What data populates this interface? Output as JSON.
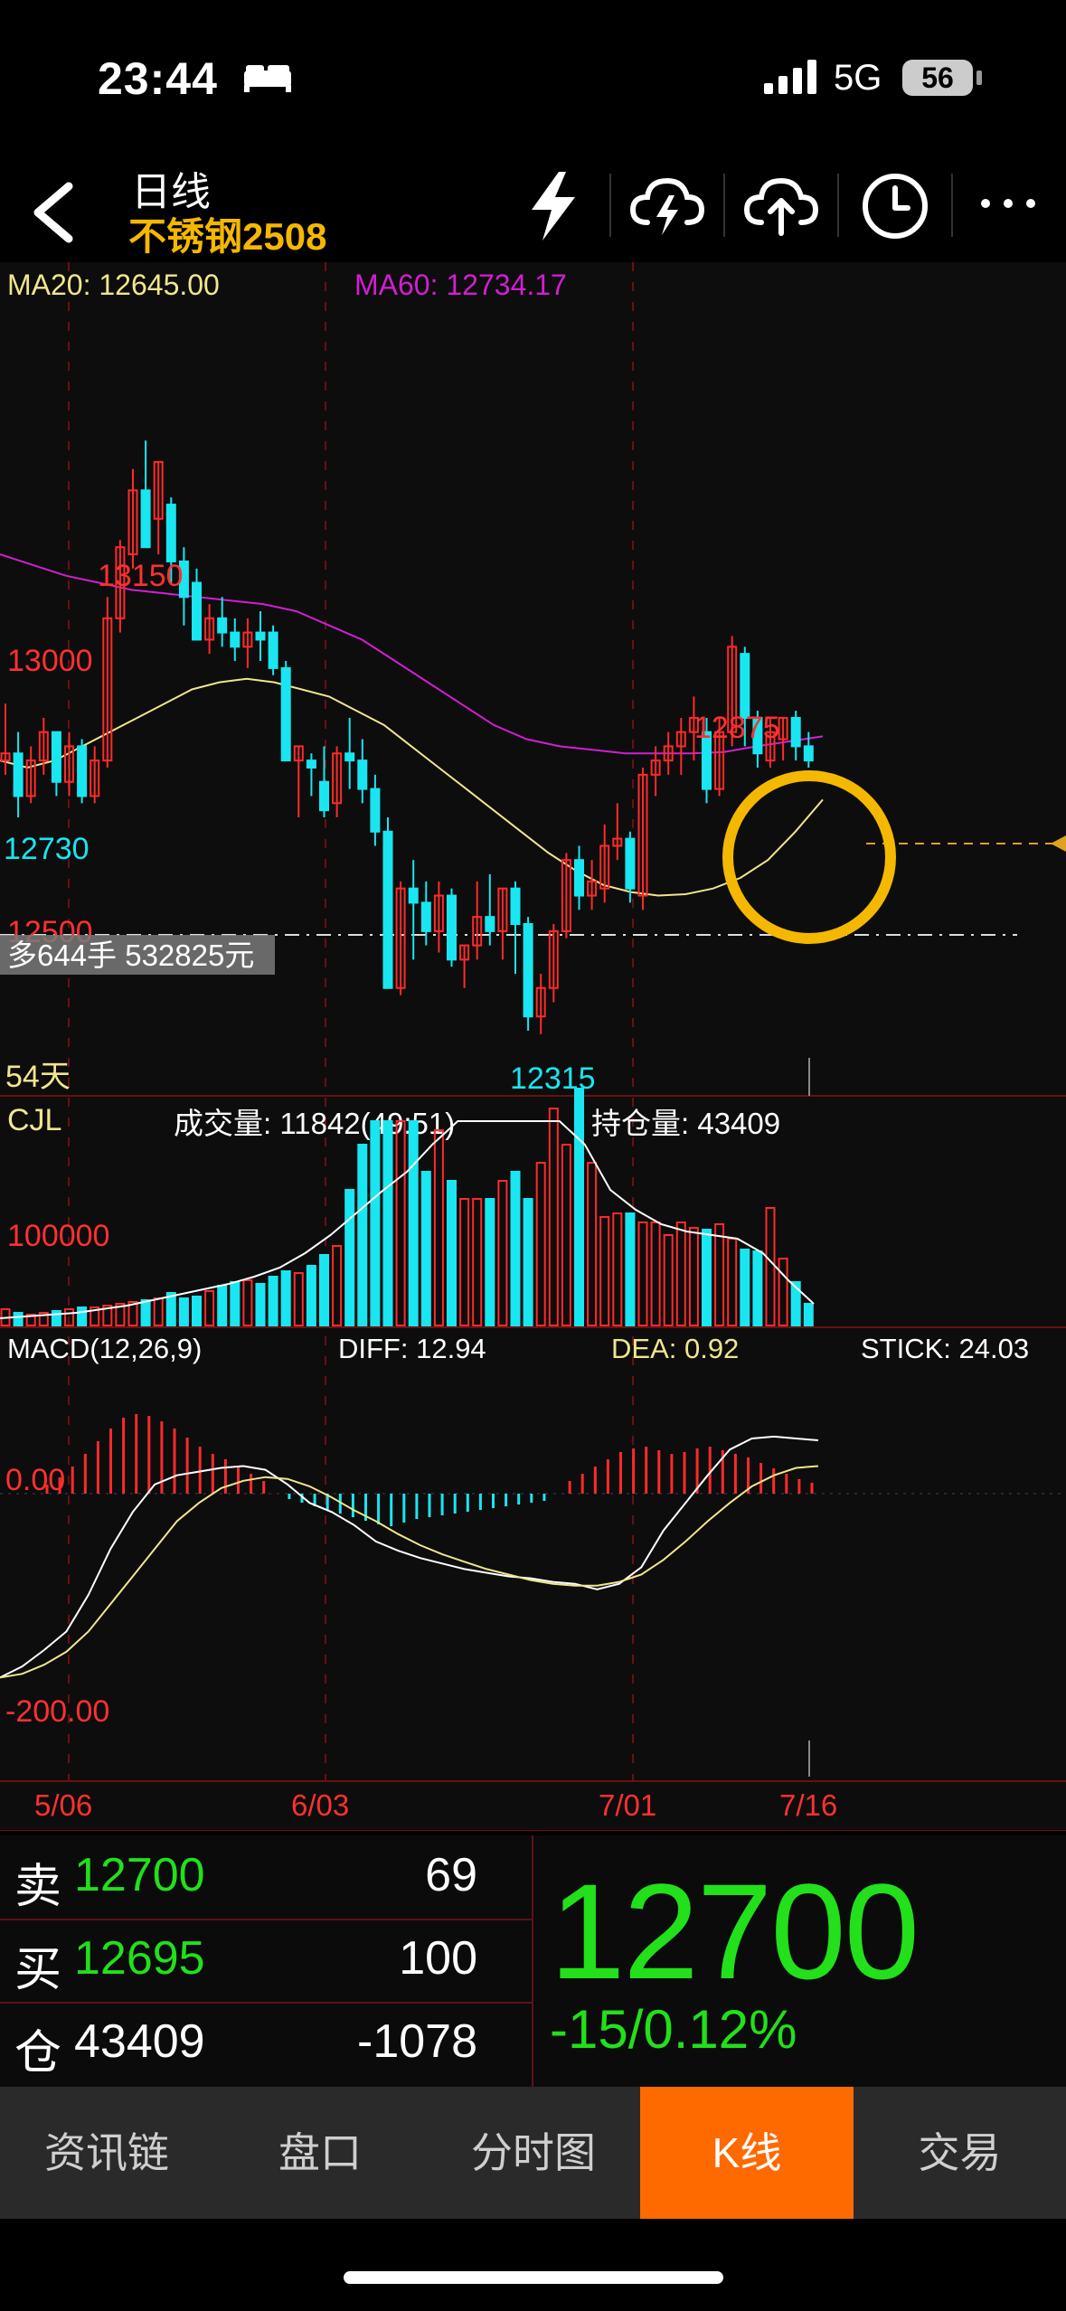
{
  "status_bar": {
    "time": "23:44",
    "network": "5G",
    "battery": "56"
  },
  "header": {
    "period": "日线",
    "symbol": "不锈钢2508"
  },
  "header_icons": [
    "flash-icon",
    "cloud-lightning-icon",
    "cloud-upload-icon",
    "clock-icon",
    "more-icon"
  ],
  "main_chart": {
    "ma20_label": "MA20: 12645.00",
    "ma60_label": "MA60: 12734.17",
    "high_label": "13150",
    "level_13000": "13000",
    "level_12730": "12730",
    "level_12500": "12500",
    "peak_label": "12875",
    "low_label": "12315",
    "position_tag": "多644手 532825元",
    "days_label": "54天"
  },
  "volume_chart": {
    "title": "CJL",
    "volume_label": "成交量: 11842(49:51)",
    "open_interest_label": "持仓量: 43409",
    "level_label": "100000"
  },
  "macd_chart": {
    "title": "MACD(12,26,9)",
    "diff_label": "DIFF: 12.94",
    "dea_label": "DEA: 0.92",
    "stick_label": "STICK: 24.03",
    "zero_label": "0.00",
    "low_label": "-200.00"
  },
  "x_axis": {
    "d1": "5/06",
    "d2": "6/03",
    "d3": "7/01",
    "d4": "7/16"
  },
  "colors": {
    "up": "#ff2a2a",
    "down": "#19e6f0",
    "ma20": "#f0e68c",
    "ma60": "#d21ed2",
    "accent": "#f5b800",
    "green": "#22e01a"
  },
  "chart_data": {
    "type": "candlestick",
    "ylim": [
      12250,
      13350
    ],
    "candles": [
      [
        12700,
        12780,
        12680,
        12710
      ],
      [
        12710,
        12740,
        12620,
        12650
      ],
      [
        12650,
        12720,
        12640,
        12700
      ],
      [
        12700,
        12760,
        12680,
        12740
      ],
      [
        12740,
        12730,
        12650,
        12670
      ],
      [
        12670,
        12740,
        12650,
        12720
      ],
      [
        12720,
        12730,
        12640,
        12650
      ],
      [
        12650,
        12720,
        12640,
        12700
      ],
      [
        12700,
        12930,
        12690,
        12900
      ],
      [
        12900,
        13010,
        12880,
        13000
      ],
      [
        12990,
        13110,
        12970,
        13080
      ],
      [
        13080,
        13150,
        13020,
        13000
      ],
      [
        13040,
        13120,
        12990,
        13120
      ],
      [
        13060,
        13070,
        12950,
        12980
      ],
      [
        12980,
        13000,
        12890,
        12930
      ],
      [
        12950,
        12970,
        12870,
        12870
      ],
      [
        12870,
        12920,
        12850,
        12900
      ],
      [
        12900,
        12930,
        12860,
        12880
      ],
      [
        12880,
        12900,
        12840,
        12860
      ],
      [
        12860,
        12900,
        12830,
        12880
      ],
      [
        12880,
        12910,
        12840,
        12870
      ],
      [
        12880,
        12890,
        12820,
        12830
      ],
      [
        12830,
        12840,
        12700,
        12700
      ],
      [
        12700,
        12720,
        12620,
        12720
      ],
      [
        12700,
        12710,
        12650,
        12690
      ],
      [
        12670,
        12720,
        12620,
        12630
      ],
      [
        12640,
        12720,
        12620,
        12710
      ],
      [
        12710,
        12760,
        12660,
        12700
      ],
      [
        12700,
        12730,
        12640,
        12660
      ],
      [
        12660,
        12680,
        12580,
        12600
      ],
      [
        12600,
        12620,
        12380,
        12380
      ],
      [
        12380,
        12530,
        12370,
        12520
      ],
      [
        12520,
        12560,
        12420,
        12500
      ],
      [
        12500,
        12530,
        12440,
        12460
      ],
      [
        12460,
        12530,
        12430,
        12510
      ],
      [
        12510,
        12520,
        12410,
        12420
      ],
      [
        12420,
        12440,
        12380,
        12440
      ],
      [
        12440,
        12530,
        12420,
        12480
      ],
      [
        12480,
        12540,
        12440,
        12460
      ],
      [
        12460,
        12520,
        12420,
        12520
      ],
      [
        12520,
        12530,
        12400,
        12470
      ],
      [
        12470,
        12480,
        12320,
        12340
      ],
      [
        12340,
        12400,
        12315,
        12380
      ],
      [
        12380,
        12470,
        12360,
        12460
      ],
      [
        12460,
        12570,
        12450,
        12560
      ],
      [
        12560,
        12580,
        12490,
        12510
      ],
      [
        12510,
        12560,
        12490,
        12530
      ],
      [
        12520,
        12610,
        12500,
        12580
      ],
      [
        12580,
        12640,
        12560,
        12590
      ],
      [
        12590,
        12600,
        12500,
        12520
      ],
      [
        12510,
        12690,
        12490,
        12680
      ],
      [
        12680,
        12720,
        12650,
        12700
      ],
      [
        12700,
        12740,
        12680,
        12720
      ],
      [
        12720,
        12760,
        12680,
        12740
      ],
      [
        12740,
        12790,
        12700,
        12760
      ],
      [
        12740,
        12760,
        12640,
        12660
      ],
      [
        12660,
        12760,
        12650,
        12740
      ],
      [
        12740,
        12875,
        12720,
        12860
      ],
      [
        12850,
        12860,
        12720,
        12760
      ],
      [
        12760,
        12770,
        12690,
        12710
      ],
      [
        12700,
        12760,
        12690,
        12740
      ],
      [
        12730,
        12760,
        12700,
        12760
      ],
      [
        12760,
        12770,
        12700,
        12720
      ],
      [
        12720,
        12740,
        12690,
        12700
      ]
    ],
    "ma20": [
      12700,
      12690,
      12700,
      12720,
      12740,
      12760,
      12780,
      12800,
      12810,
      12815,
      12810,
      12800,
      12790,
      12770,
      12750,
      12720,
      12690,
      12660,
      12630,
      12600,
      12570,
      12545,
      12525,
      12515,
      12510,
      12512,
      12520,
      12535,
      12560,
      12600,
      12645
    ],
    "ma60": [
      12990,
      12975,
      12960,
      12950,
      12940,
      12935,
      12930,
      12925,
      12920,
      12910,
      12890,
      12870,
      12840,
      12810,
      12780,
      12750,
      12730,
      12720,
      12715,
      12710,
      12710,
      12710,
      12712,
      12720,
      12727,
      12734
    ],
    "volume": {
      "levels": [
        100000
      ],
      "last_volume": 11842,
      "open_interest": 43409
    },
    "macd": {
      "diff": 12.94,
      "dea": 0.92,
      "stick": 24.03,
      "ylim": [
        -220,
        60
      ]
    }
  },
  "quote": {
    "sell_label": "卖",
    "sell_price": "12700",
    "sell_qty": "69",
    "buy_label": "买",
    "buy_price": "12695",
    "buy_qty": "100",
    "oi_label": "仓",
    "oi_value": "43409",
    "oi_change": "-1078",
    "last_price": "12700",
    "change": "-15/0.12%"
  },
  "tabs": [
    {
      "label": "资讯链",
      "active": false
    },
    {
      "label": "盘口",
      "active": false
    },
    {
      "label": "分时图",
      "active": false
    },
    {
      "label": "K线",
      "active": true
    },
    {
      "label": "交易",
      "active": false
    }
  ]
}
